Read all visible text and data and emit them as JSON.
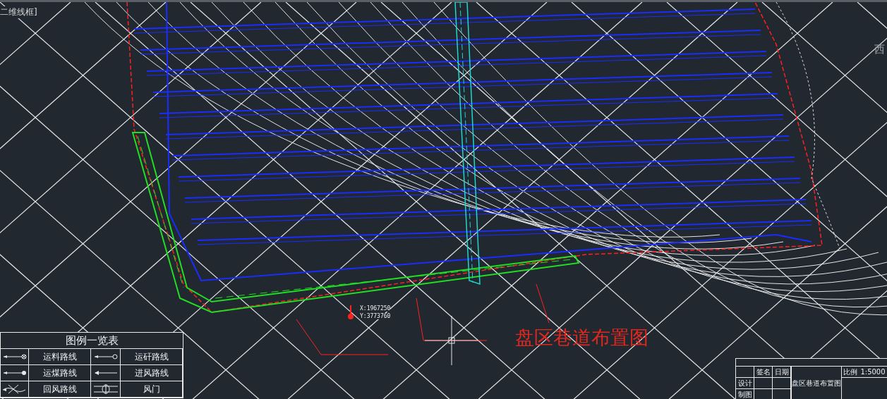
{
  "viewport_label": "二维线框]",
  "viewcube_label": "西",
  "drawing_title": "盘区巷道布置图",
  "annotations": [
    {
      "text": "X:1967250"
    },
    {
      "text": "Y:3773760"
    }
  ],
  "legend": {
    "title": "图例一览表",
    "items": [
      {
        "label": "运料路线",
        "kind": "material"
      },
      {
        "label": "运矸路线",
        "kind": "waste"
      },
      {
        "label": "运煤路线",
        "kind": "coal"
      },
      {
        "label": "进风路线",
        "kind": "intake"
      },
      {
        "label": "回风路线",
        "kind": "return"
      },
      {
        "label": "风门",
        "kind": "door"
      }
    ]
  },
  "title_block": {
    "title": "盘区巷道布置图",
    "headers": [
      "签名",
      "日期"
    ],
    "roles": [
      "设计",
      "制图"
    ],
    "scale_label": "比例",
    "scale": "1:5000"
  }
}
